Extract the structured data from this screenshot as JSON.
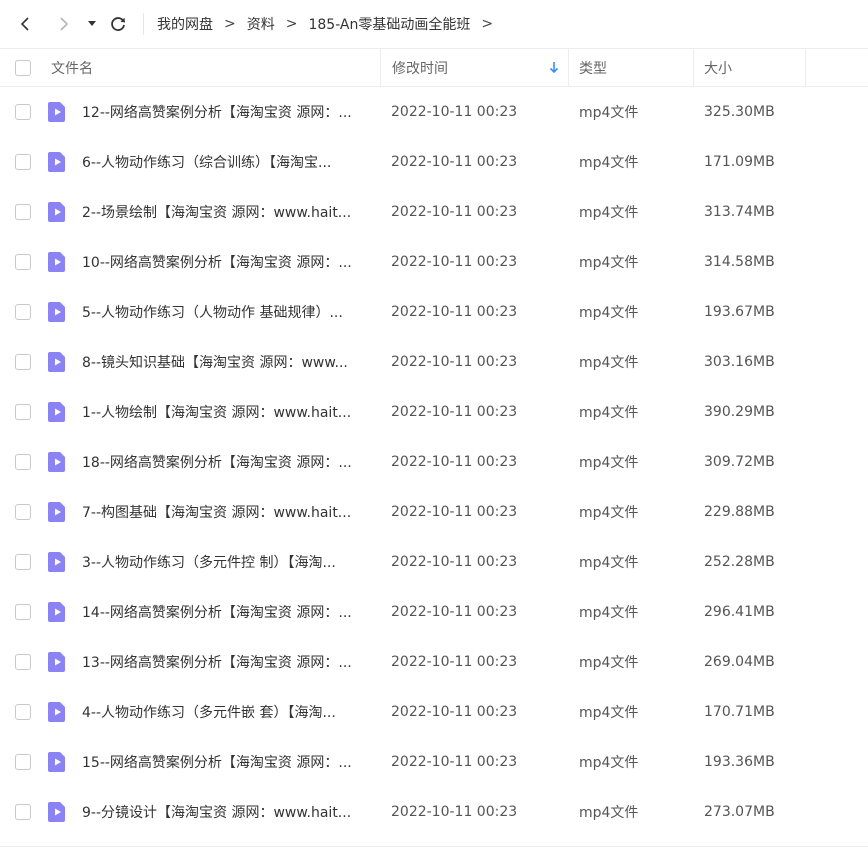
{
  "toolbar": {
    "back_icon": "chevron-left-icon",
    "forward_icon": "chevron-right-icon",
    "dropdown_icon": "caret-down-icon",
    "refresh_icon": "refresh-icon",
    "breadcrumbs": [
      "我的网盘",
      "资料",
      "185-An零基础动画全能班"
    ],
    "separator": ">"
  },
  "table": {
    "columns": {
      "name": "文件名",
      "mtime": "修改时间",
      "type": "类型",
      "size": "大小"
    },
    "sort_icon": "sort-arrow-down-icon",
    "accent_color": "#3b8cff",
    "file_icon_color": "#8b83f3",
    "rows": [
      {
        "name": "12--网络高赞案例分析【海淘宝资 源网：...",
        "mtime": "2022-10-11 00:23",
        "type": "mp4文件",
        "size": "325.30MB"
      },
      {
        "name": "6--人物动作练习（综合训练）【海淘宝...",
        "mtime": "2022-10-11 00:23",
        "type": "mp4文件",
        "size": "171.09MB"
      },
      {
        "name": "2--场景绘制【海淘宝资 源网：www.hait...",
        "mtime": "2022-10-11 00:23",
        "type": "mp4文件",
        "size": "313.74MB"
      },
      {
        "name": "10--网络高赞案例分析【海淘宝资 源网：...",
        "mtime": "2022-10-11 00:23",
        "type": "mp4文件",
        "size": "314.58MB"
      },
      {
        "name": "5--人物动作练习（人物动作 基础规律）...",
        "mtime": "2022-10-11 00:23",
        "type": "mp4文件",
        "size": "193.67MB"
      },
      {
        "name": "8--镜头知识基础【海淘宝资 源网：www...",
        "mtime": "2022-10-11 00:23",
        "type": "mp4文件",
        "size": "303.16MB"
      },
      {
        "name": "1--人物绘制【海淘宝资 源网：www.hait...",
        "mtime": "2022-10-11 00:23",
        "type": "mp4文件",
        "size": "390.29MB"
      },
      {
        "name": "18--网络高赞案例分析【海淘宝资 源网：...",
        "mtime": "2022-10-11 00:23",
        "type": "mp4文件",
        "size": "309.72MB"
      },
      {
        "name": "7--构图基础【海淘宝资 源网：www.hait...",
        "mtime": "2022-10-11 00:23",
        "type": "mp4文件",
        "size": "229.88MB"
      },
      {
        "name": "3--人物动作练习（多元件控 制）【海淘...",
        "mtime": "2022-10-11 00:23",
        "type": "mp4文件",
        "size": "252.28MB"
      },
      {
        "name": "14--网络高赞案例分析【海淘宝资 源网：...",
        "mtime": "2022-10-11 00:23",
        "type": "mp4文件",
        "size": "296.41MB"
      },
      {
        "name": "13--网络高赞案例分析【海淘宝资 源网：...",
        "mtime": "2022-10-11 00:23",
        "type": "mp4文件",
        "size": "269.04MB"
      },
      {
        "name": "4--人物动作练习（多元件嵌 套）【海淘...",
        "mtime": "2022-10-11 00:23",
        "type": "mp4文件",
        "size": "170.71MB"
      },
      {
        "name": "15--网络高赞案例分析【海淘宝资 源网：...",
        "mtime": "2022-10-11 00:23",
        "type": "mp4文件",
        "size": "193.36MB"
      },
      {
        "name": "9--分镜设计【海淘宝资 源网：www.hait...",
        "mtime": "2022-10-11 00:23",
        "type": "mp4文件",
        "size": "273.07MB"
      }
    ]
  }
}
